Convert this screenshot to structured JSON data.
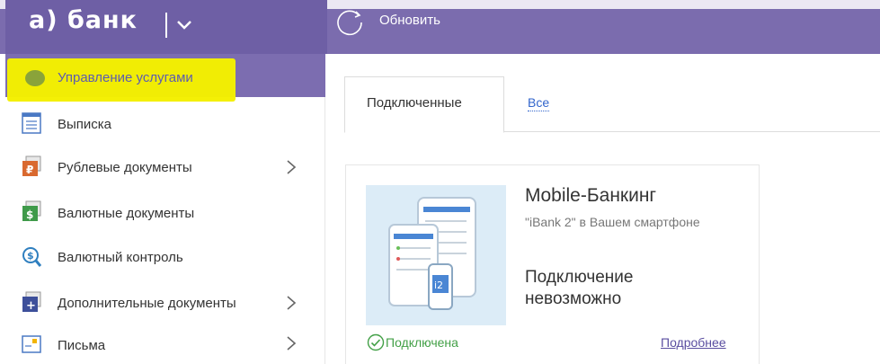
{
  "header": {
    "logo_text": "а) банк",
    "refresh_label": "Обновить",
    "colors": {
      "bar": "#7b6cae",
      "accent": "#6e5fa5"
    }
  },
  "sidebar": {
    "active_label": "Управление услугами",
    "items": [
      {
        "label": "Выписка",
        "icon": "statement-icon",
        "has_submenu": false
      },
      {
        "label": "Рублевые документы",
        "icon": "ruble-documents-icon",
        "has_submenu": true
      },
      {
        "label": "Валютные документы",
        "icon": "currency-documents-icon",
        "has_submenu": false
      },
      {
        "label": "Валютный контроль",
        "icon": "currency-control-icon",
        "has_submenu": false
      },
      {
        "label": "Дополнительные документы",
        "icon": "additional-documents-icon",
        "has_submenu": true
      },
      {
        "label": "Письма",
        "icon": "letters-icon",
        "has_submenu": true
      }
    ]
  },
  "tabs": [
    {
      "label": "Подключенные",
      "active": true
    },
    {
      "label": "Все",
      "active": false
    }
  ],
  "card": {
    "title": "Mobile-Банкинг",
    "subtitle": "\"iBank 2\" в Вашем смартфоне",
    "status": "Подключение невозможно",
    "connected_label": "Подключена",
    "more_link": "Подробнее"
  }
}
